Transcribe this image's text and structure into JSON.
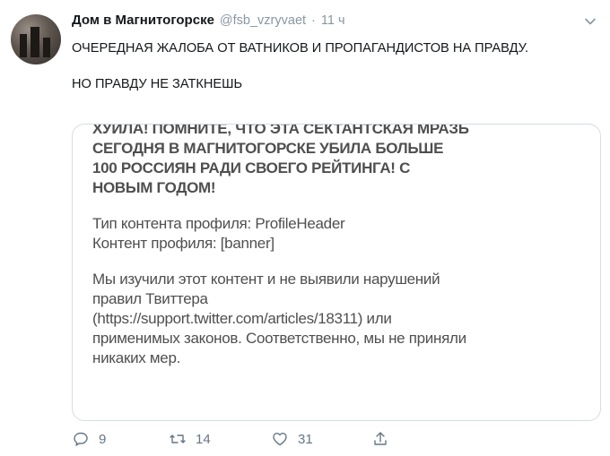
{
  "tweet": {
    "author_name": "Дом в Магнитогорске",
    "handle": "@fsb_vzryvaet",
    "separator": "·",
    "time": "11 ч",
    "text_line1": "ОЧЕРЕДНАЯ ЖАЛОБА ОТ ВАТНИКОВ И ПРОПАГАНДИСТОВ НА ПРАВДУ.",
    "text_line2": "НО ПРАВДУ НЕ ЗАТКНЕШЬ"
  },
  "media": {
    "lines": [
      "ХУЙЛА! ПОМНИТЕ, ЧТО ЭТА СЕКТАНТСКАЯ МРАЗЬ",
      "СЕГОДНЯ В МАГНИТОГОРСКЕ УБИЛА БОЛЬШЕ",
      "100 РОССИЯН РАДИ СВОЕГО РЕЙТИНГА! С",
      "НОВЫМ ГОДОМ!",
      "Тип контента профиля: ProfileHeader",
      "Контент профиля: [banner]",
      "Мы изучили этот контент и не выявили нарушений",
      "правил Твиттера",
      "(https://support.twitter.com/articles/18311) или",
      "применимых законов. Соответственно, мы не приняли",
      "никаких мер."
    ]
  },
  "actions": {
    "reply_count": "9",
    "retweet_count": "14",
    "like_count": "31"
  },
  "icons": {
    "reply": "reply-icon",
    "retweet": "retweet-icon",
    "like": "like-icon",
    "share": "share-icon",
    "menu": "chevron-down-icon"
  }
}
